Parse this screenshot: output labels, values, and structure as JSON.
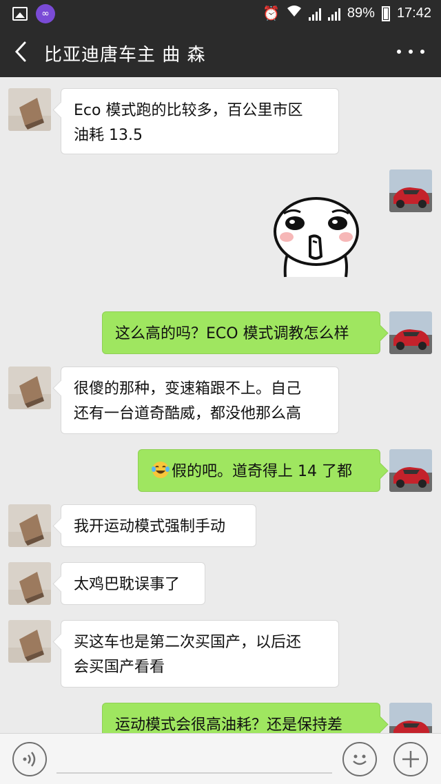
{
  "status_bar": {
    "battery": "89%",
    "time": "17:42",
    "icons": [
      "gallery-icon",
      "app-infinity-icon",
      "alarm-icon",
      "wifi-icon",
      "signal-icon",
      "signal-icon",
      "battery-icon"
    ]
  },
  "header": {
    "title": "比亚迪唐车主 曲 森",
    "back_icon": "chevron-left-icon",
    "more_icon": "more-dots-icon"
  },
  "messages": [
    {
      "side": "in",
      "lines": [
        "Eco 模式跑的比较多，百公里市区",
        "油耗 13.5"
      ]
    },
    {
      "side": "out",
      "type": "sticker",
      "sticker": "shy-face-sticker"
    },
    {
      "side": "out",
      "lines": [
        "这么高的吗？ECO 模式调教怎么样"
      ]
    },
    {
      "side": "in",
      "lines": [
        "很傻的那种，变速箱跟不上。自己",
        "还有一台道奇酷威，都没他那么高"
      ]
    },
    {
      "side": "out",
      "emoji": "laughing-tears-emoji",
      "lines": [
        "假的吧。道奇得上 14 了都"
      ]
    },
    {
      "side": "in",
      "lines": [
        "我开运动模式强制手动"
      ]
    },
    {
      "side": "in",
      "lines": [
        "太鸡巴耽误事了"
      ]
    },
    {
      "side": "in",
      "lines": [
        "买这车也是第二次买国产，以后还",
        "会买国产看看"
      ]
    },
    {
      "side": "out",
      "lines": [
        "运动模式会很高油耗？还是保持差"
      ]
    }
  ],
  "input_bar": {
    "voice_icon": "voice-icon",
    "emoji_icon": "emoji-face-icon",
    "plus_icon": "plus-icon",
    "text_value": ""
  },
  "colors": {
    "title_bar": "#2b2b2b",
    "background": "#ebebeb",
    "bubble_out": "#9fe660",
    "bubble_in": "#ffffff"
  }
}
